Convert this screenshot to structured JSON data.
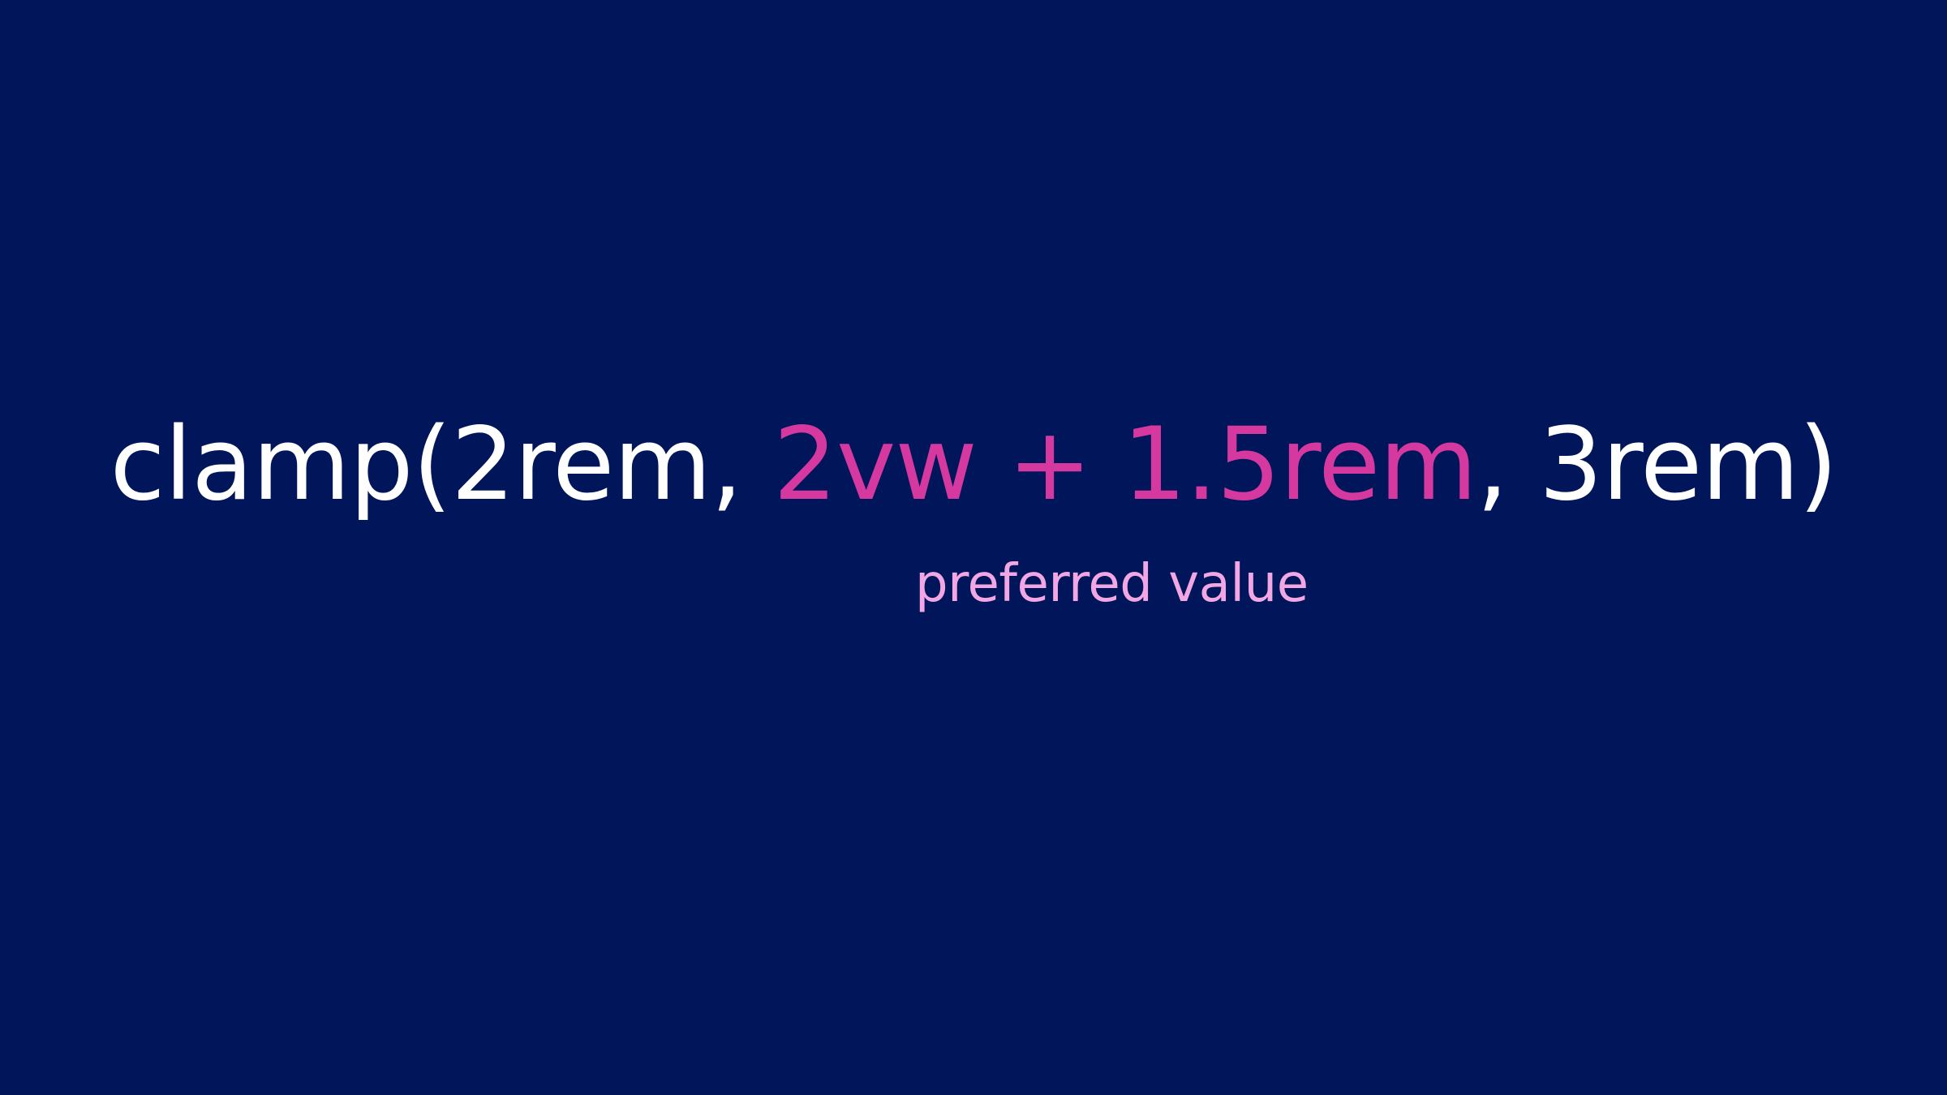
{
  "slide": {
    "formula": {
      "function_open": "clamp(",
      "min_value": "2rem",
      "separator_1": ", ",
      "preferred_value": "2vw + 1.5rem",
      "separator_2": ", ",
      "max_value": "3rem",
      "function_close": ")"
    },
    "annotation": "preferred value"
  },
  "colors": {
    "background": "#00155a",
    "text": "#ffffff",
    "highlight": "#d5399f",
    "annotation": "#f2a6e4"
  }
}
